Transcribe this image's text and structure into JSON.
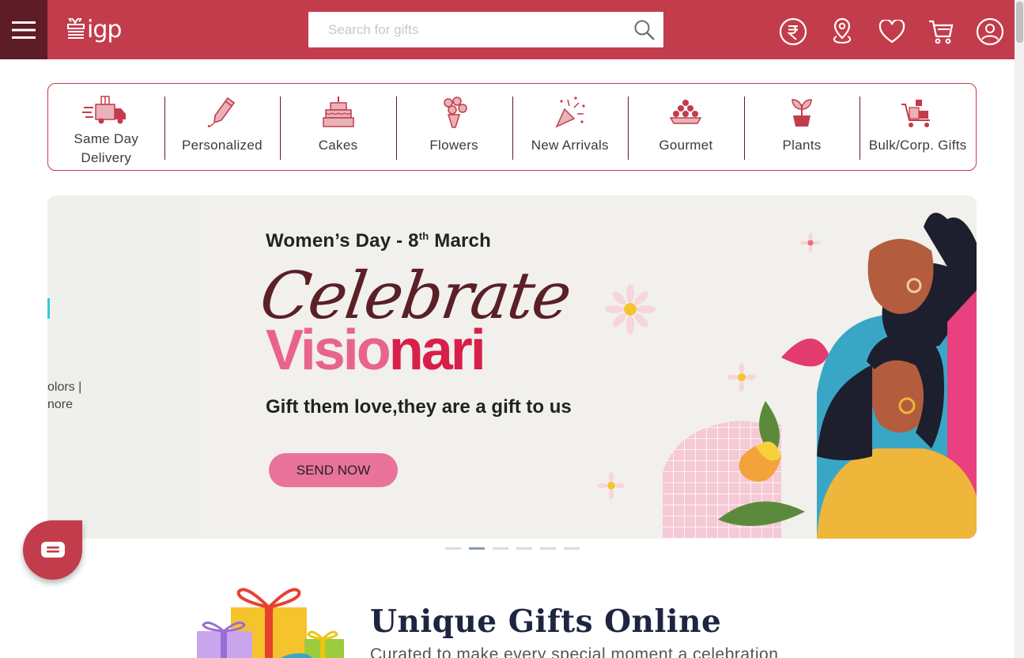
{
  "header": {
    "logo_text": "igp",
    "search_placeholder": "Search for gifts",
    "icons": [
      "rupee-icon",
      "location-icon",
      "heart-icon",
      "cart-icon",
      "user-icon"
    ]
  },
  "categories": [
    {
      "label": "Same Day Delivery",
      "line1": "Same Day",
      "line2": "Delivery",
      "icon": "delivery-truck-icon"
    },
    {
      "label": "Personalized",
      "icon": "pen-icon"
    },
    {
      "label": "Cakes",
      "icon": "cake-icon"
    },
    {
      "label": "Flowers",
      "icon": "bouquet-icon"
    },
    {
      "label": "New Arrivals",
      "icon": "party-popper-icon"
    },
    {
      "label": "Gourmet",
      "icon": "sweets-icon"
    },
    {
      "label": "Plants",
      "icon": "plant-icon"
    },
    {
      "label": "Bulk/Corp. Gifts",
      "icon": "bulk-cart-icon"
    }
  ],
  "banner": {
    "heading_main": "Women’s Day - 8",
    "heading_sup": "th",
    "heading_end": " March",
    "script_text": "Celebrate",
    "vis_part1": "Visio",
    "vis_part2": "nari",
    "subtitle": "Gift them love,they are a gift to us",
    "cta": "SEND NOW",
    "prev_slide_line1": "olors |",
    "prev_slide_line2": "nore"
  },
  "carousel": {
    "slides": 6,
    "active": 2
  },
  "section": {
    "title": "Unique Gifts Online",
    "subtitle": "Curated to make every special moment a celebration"
  },
  "colors": {
    "brand": "#c33c4b",
    "brand_dark": "#5e1c26",
    "pink": "#e9739a"
  }
}
